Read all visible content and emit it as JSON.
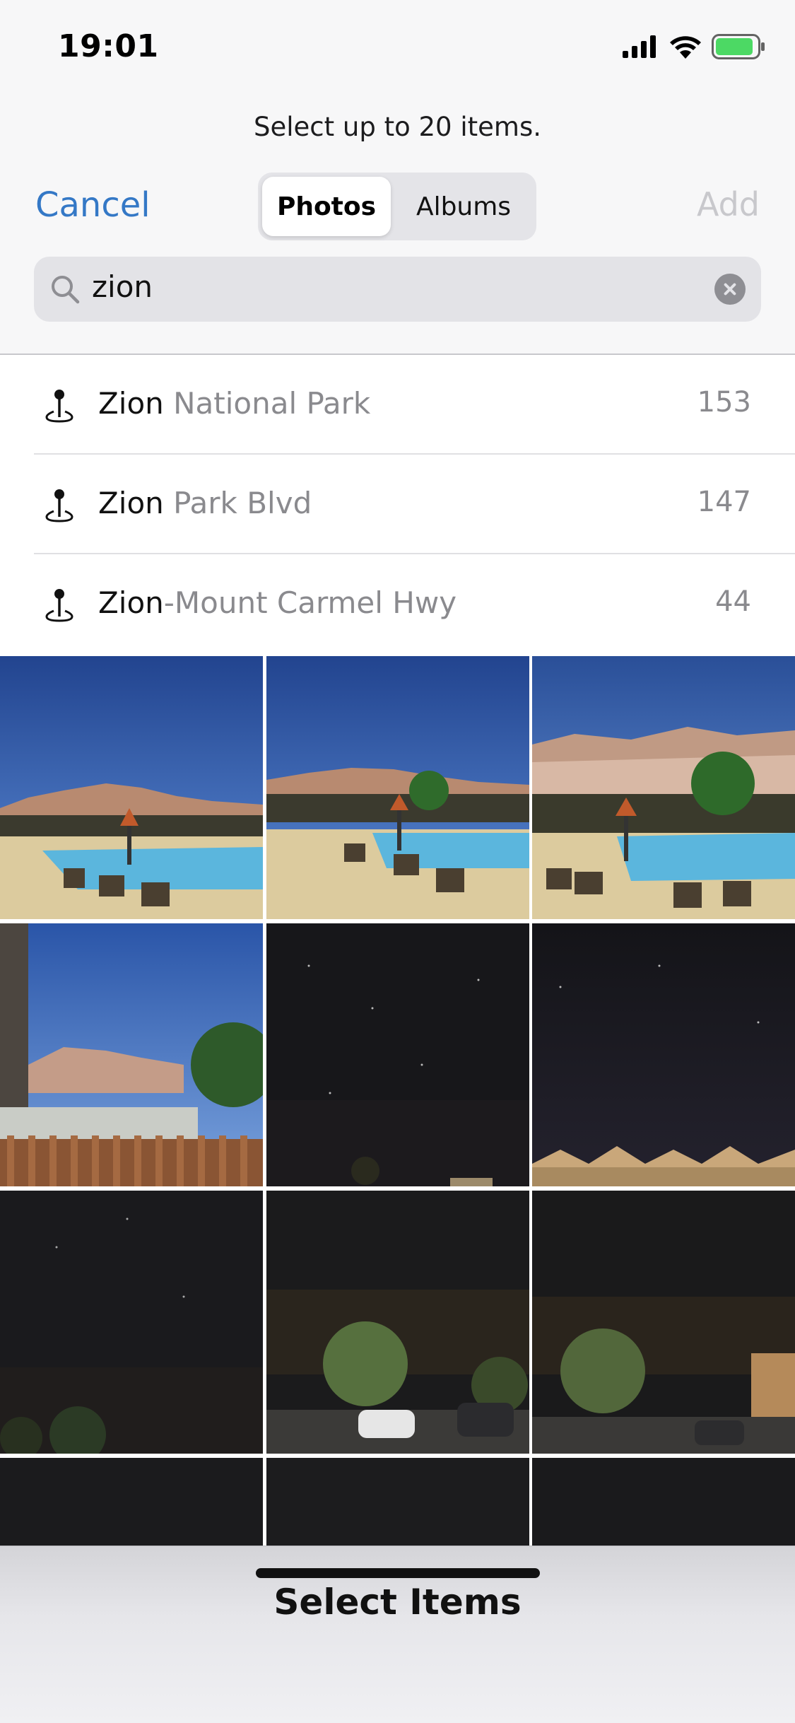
{
  "status_bar": {
    "time": "19:01"
  },
  "header": {
    "prompt": "Select up to 20 items.",
    "cancel_label": "Cancel",
    "add_label": "Add",
    "tabs": [
      {
        "label": "Photos",
        "selected": true
      },
      {
        "label": "Albums",
        "selected": false
      }
    ]
  },
  "search": {
    "value": "zion"
  },
  "suggestions": [
    {
      "match": "Zion",
      "rest": " National Park",
      "count": "153"
    },
    {
      "match": "Zion",
      "rest": " Park Blvd",
      "count": "147"
    },
    {
      "match": "Zion",
      "rest": "-Mount Carmel Hwy",
      "count": "44"
    }
  ],
  "photos": [
    {
      "scene": "day-pool"
    },
    {
      "scene": "day-pool"
    },
    {
      "scene": "day-pool"
    },
    {
      "scene": "day-fence"
    },
    {
      "scene": "night-sky"
    },
    {
      "scene": "night-houses"
    },
    {
      "scene": "night-sky-trees"
    },
    {
      "scene": "night-cars"
    },
    {
      "scene": "night-cars"
    },
    {
      "scene": "night-dark"
    },
    {
      "scene": "night-dark"
    },
    {
      "scene": "night-dark"
    }
  ],
  "bottom_bar": {
    "label": "Select Items"
  },
  "colors": {
    "accent": "#3478c6",
    "battery": "#4cd964"
  }
}
